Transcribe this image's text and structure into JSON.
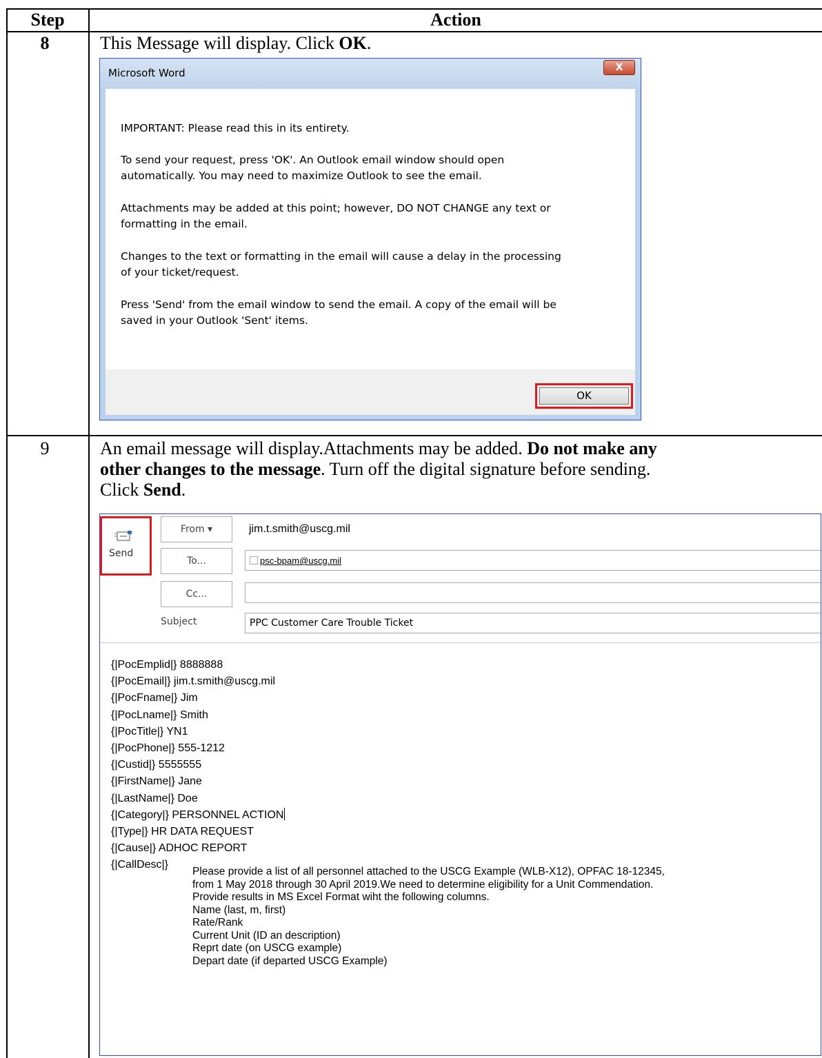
{
  "table": {
    "headers": {
      "step": "Step",
      "action": "Action"
    },
    "steps": [
      {
        "number": "8",
        "instruction_parts": [
          "This Message will display. Click ",
          "OK",
          "."
        ]
      },
      {
        "number": "9",
        "instruction_line1_parts": [
          "An email message will display.Attachments may be added. ",
          "Do not make any"
        ],
        "instruction_line2_parts": [
          "other changes to the message",
          ". Turn off the digital signature before sending."
        ],
        "instruction_line3_parts": [
          "Click ",
          "Send",
          "."
        ]
      }
    ]
  },
  "dialog": {
    "title": "Microsoft Word",
    "close_glyph": "X",
    "paragraphs": [
      "IMPORTANT: Please read this in its entirety.",
      "To send your request, press 'OK'. An Outlook email window should open",
      "automatically. You may need to maximize Outlook to see the email.",
      "Attachments may be added at this point; however, DO NOT CHANGE any text or",
      "formatting in the email.",
      "Changes to the text or formatting in the email will cause a delay in the processing",
      "of your ticket/request.",
      "Press 'Send' from the email window to send the email. A copy of the email will be",
      "saved in your Outlook 'Sent' items."
    ],
    "ok_label": "OK"
  },
  "email": {
    "send_label": "Send",
    "from_button": "From ▾",
    "from_value": "jim.t.smith@uscg.mil",
    "to_button": "To...",
    "to_value": "psc-bpam@uscg.mil",
    "cc_button": "Cc...",
    "cc_value": "",
    "subject_label": "Subject",
    "subject_value": "PPC Customer Care Trouble Ticket",
    "body_rows": [
      {
        "key": "{|PocEmplid|}",
        "value": " 8888888"
      },
      {
        "key": "{|PocEmail|}",
        "value": " jim.t.smith@uscg.mil"
      },
      {
        "key": "{|PocFname|}",
        "value": " Jim"
      },
      {
        "key": "{|PocLname|}",
        "value": " Smith"
      },
      {
        "key": "{|PocTitle|}",
        "value": " YN1"
      },
      {
        "key": "{|PocPhone|}",
        "value": " 555-1212"
      },
      {
        "key": "{|Custid|}",
        "value": " 5555555"
      },
      {
        "key": "{|FirstName|}",
        "value": " Jane"
      },
      {
        "key": "{|LastName|}",
        "value": " Doe"
      },
      {
        "key": "{|Category|}",
        "value": " PERSONNEL ACTION"
      },
      {
        "key": "{|Type|}",
        "value": " HR DATA REQUEST"
      },
      {
        "key": "{|Cause|}",
        "value": " ADHOC REPORT"
      },
      {
        "key": "{|CallDesc|}",
        "value": ""
      }
    ],
    "call_desc_lines": [
      "Please provide a list of all personnel attached to the USCG Example (WLB-X12), OPFAC 18-12345,",
      "from 1 May 2018 through 30 April 2019.We need to determine eligibility for a Unit Commendation.",
      "Provide results in MS Excel Format wiht the following columns.",
      "Name (last, m, first)",
      "Rate/Rank",
      "Current Unit (ID an description)",
      "Reprt date (on USCG example)",
      "Depart date (if departed USCG Example)"
    ]
  },
  "colors": {
    "highlight": "#e01a1a",
    "dialog_border": "#2f54c9",
    "email_border": "#3b46c8"
  }
}
